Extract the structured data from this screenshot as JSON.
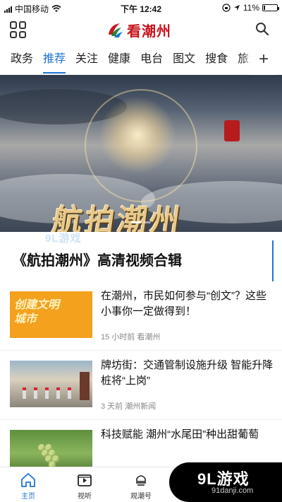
{
  "status_bar": {
    "carrier": "中国移动",
    "time": "下午 12:42",
    "battery": "11%",
    "battery_level": 0.11
  },
  "header": {
    "logo_text": "看潮州",
    "logo_icon": "chaozhou-logo-icon",
    "menu_icon": "grid-menu-icon",
    "search_icon": "search-icon"
  },
  "nav": {
    "tabs": [
      "政务",
      "推荐",
      "关注",
      "健康",
      "电台",
      "图文",
      "搜食",
      "旅游"
    ],
    "active_tab": "推荐",
    "add_label": "+"
  },
  "banner": {
    "title": "航拍潮州",
    "slide_count": 2,
    "active_slide": 1
  },
  "section": {
    "title": "《航拍潮州》高清视频合辑"
  },
  "news": [
    {
      "title": "在潮州，市民如何参与“创文”？这些小事你一定做得到！",
      "meta": "15 小时前 看潮州",
      "thumb_text": [
        "创建文明",
        "城市"
      ]
    },
    {
      "title": "牌坊街：交通管制设施升级 智能升降桩将“上岗”",
      "meta": "3 天前 潮州新闻"
    },
    {
      "title": "科技赋能 潮州“水尾田”种出甜葡萄",
      "meta": ""
    }
  ],
  "tabbar": {
    "items": [
      {
        "label": "主页",
        "icon": "home-icon"
      },
      {
        "label": "视听",
        "icon": "video-icon"
      },
      {
        "label": "观潮号",
        "icon": "guanchao-icon"
      }
    ],
    "active": "主页"
  },
  "watermark": {
    "logo": "9L游戏",
    "url": "91danji.com",
    "banner_mark": "9L游戏"
  },
  "colors": {
    "accent": "#1e73d6",
    "brand_red": "#c7161e"
  }
}
